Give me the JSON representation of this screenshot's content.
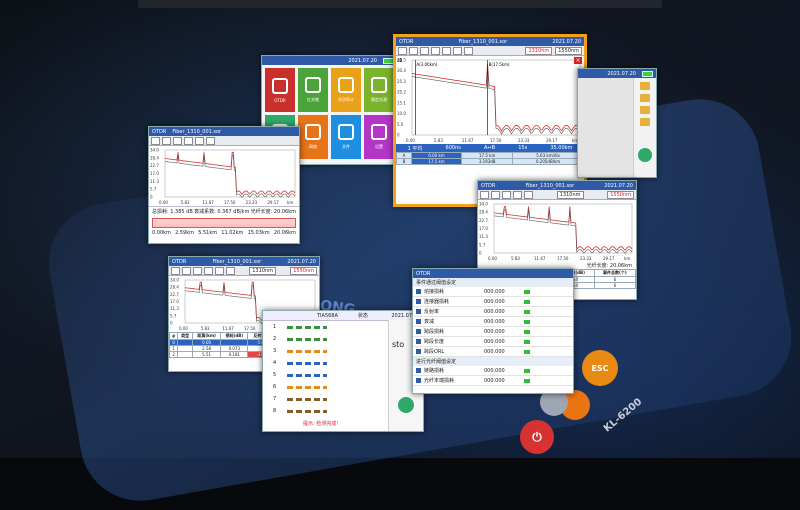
{
  "device": {
    "model": "KL-6200",
    "brand_fragment": "ONG",
    "esc_key": "ESC"
  },
  "colors": {
    "title_bar": "#2f5aa7",
    "trace": "#d93030",
    "highlight_frame": "#f2a21a",
    "status_blue": "#2a63c0"
  },
  "menu_screen": {
    "date": "2021.07.20",
    "tiles": [
      {
        "label": "OTDR",
        "color": "#c9302c",
        "icon": "trace-icon"
      },
      {
        "label": "红光笔",
        "color": "#4aa43a",
        "icon": "laser-icon"
      },
      {
        "label": "光功率计",
        "color": "#e9a11a",
        "icon": "power-meter-icon"
      },
      {
        "label": "稳定光源",
        "color": "#7bb32e",
        "icon": "light-source-icon"
      },
      {
        "label": "端面",
        "color": "#2fa86a",
        "icon": "endface-icon"
      },
      {
        "label": "网络",
        "color": "#e8741a",
        "icon": "network-icon"
      },
      {
        "label": "文件",
        "color": "#1e8ee0",
        "icon": "folder-icon"
      },
      {
        "label": "设置",
        "color": "#b435c6",
        "icon": "gear-icon"
      }
    ]
  },
  "main_screen": {
    "app": "OTDR",
    "file": "Fiber_1310_001.sor",
    "date": "2021.07.20",
    "wl_active": "1310nm",
    "wl_other": "1550nm",
    "y_unit": "dB",
    "y_ticks": [
      "35.5",
      "30.4",
      "25.3",
      "20.2",
      "15.1",
      "10.0",
      "5.0",
      "0"
    ],
    "x_ticks": [
      "0.00",
      "5.83",
      "11.67",
      "17.50",
      "23.33",
      "29.17",
      "km"
    ],
    "marker_a": "A(3.00km)",
    "marker_b": "B(17.5km)",
    "status": [
      "1 平均",
      "600ns",
      "A↔B",
      "15s",
      "35.00km"
    ],
    "rows": [
      {
        "k": "A",
        "v1": "0.00 km",
        "v2": "",
        "v3": "17.5 km",
        "v4": "5.63 km/div"
      },
      {
        "k": "B",
        "v1": "17.5 km",
        "v2": "",
        "v3": "3.193dB",
        "v4": "0.205dB/km"
      }
    ],
    "row_labels": [
      "损耗"
    ]
  },
  "left_screen": {
    "app": "OTDR",
    "file": "Fiber_1310_001.sor",
    "y_ticks": [
      "34.0",
      "28.4",
      "22.7",
      "17.0",
      "11.3",
      "5.7",
      "0"
    ],
    "x_ticks": [
      "0.00",
      "5.83",
      "11.67",
      "17.50",
      "23.33",
      "29.17",
      "km"
    ],
    "summary": [
      "总损耗: 1.385 dB",
      "衰减系数: 0.367 dB/km",
      "光纤长度: 20.06km"
    ],
    "events_nav": [
      "0.00km",
      "2.59km",
      "5.51km",
      "11.02km",
      "15.03km",
      "20.06km"
    ]
  },
  "right_top_screen": {
    "date": "2021.07.20",
    "icons": [
      "save-icon",
      "open-icon",
      "scan-icon",
      "share-icon"
    ]
  },
  "right_mid_screen": {
    "app": "OTDR",
    "file": "Fiber_1310_001.sor",
    "date": "2021.07.20",
    "wl_active": "1310nm",
    "wl_other": "1550nm",
    "y_unit": "dB",
    "y_ticks": [
      "34.0",
      "28.4",
      "22.7",
      "17.0",
      "11.3",
      "5.7",
      "0"
    ],
    "x_ticks": [
      "0.00",
      "5.83",
      "11.67",
      "17.50",
      "23.33",
      "29.17",
      "km"
    ],
    "fiber_length": "光纤长度: 20.06km",
    "headers": [
      "波长(nm)",
      "总损耗(dB)",
      "衰减系数(dB)",
      "事件总数(个)"
    ],
    "rows": [
      [
        "1310",
        "7.103",
        "0.354",
        "6"
      ],
      [
        "1550",
        "6.103",
        "0.304",
        "6"
      ]
    ]
  },
  "bottom_left_screen": {
    "app": "OTDR",
    "file": "Fiber_1310_001.sor",
    "date": "2021.07.20",
    "wl_active": "1310nm",
    "wl_other": "1550nm",
    "y_unit": "dB",
    "y_ticks": [
      "34.0",
      "28.4",
      "22.7",
      "17.0",
      "11.3",
      "5.7",
      "0"
    ],
    "x_ticks": [
      "0.00",
      "5.83",
      "11.67",
      "17.50",
      "23.33",
      "29.17",
      "km"
    ],
    "headers": [
      "#",
      "类型",
      "距离(km)",
      "损耗(dB)",
      "反射率(dB)",
      "斜率(dB/km)"
    ],
    "rows": [
      [
        "0",
        "",
        "0.00",
        "",
        "-54.617",
        "0.311"
      ],
      [
        "1",
        "",
        "2.58",
        "0.073",
        "",
        "0.311"
      ],
      [
        "2",
        "",
        "5.51",
        "0.181",
        "-31.267",
        "0.314"
      ]
    ]
  },
  "bottom_mid_screen": {
    "title": "TIA568A",
    "col_status": "状态",
    "date": "2021.07.20",
    "btn": "sto",
    "rows": [
      "1",
      "2",
      "3",
      "4",
      "5",
      "6",
      "7",
      "8"
    ],
    "notice": "提示: 检测完成!"
  },
  "bottom_right_screen": {
    "app": "OTDR",
    "section1": "事件通过阈值设定",
    "items": [
      {
        "label": "熔接损耗",
        "value": "000.000"
      },
      {
        "label": "连接器损耗",
        "value": "000.000"
      },
      {
        "label": "反射率",
        "value": "000.000"
      },
      {
        "label": "衰减",
        "value": "000.000"
      },
      {
        "label": "跨段损耗",
        "value": "000.000"
      },
      {
        "label": "跨段长度",
        "value": "000.000"
      },
      {
        "label": "跨段ORL",
        "value": "000.000"
      }
    ],
    "section2": "进行光纤阈值设定",
    "items2": [
      {
        "label": "链路损耗",
        "value": "000.000"
      },
      {
        "label": "光纤末端损耗",
        "value": "000.000"
      }
    ]
  }
}
